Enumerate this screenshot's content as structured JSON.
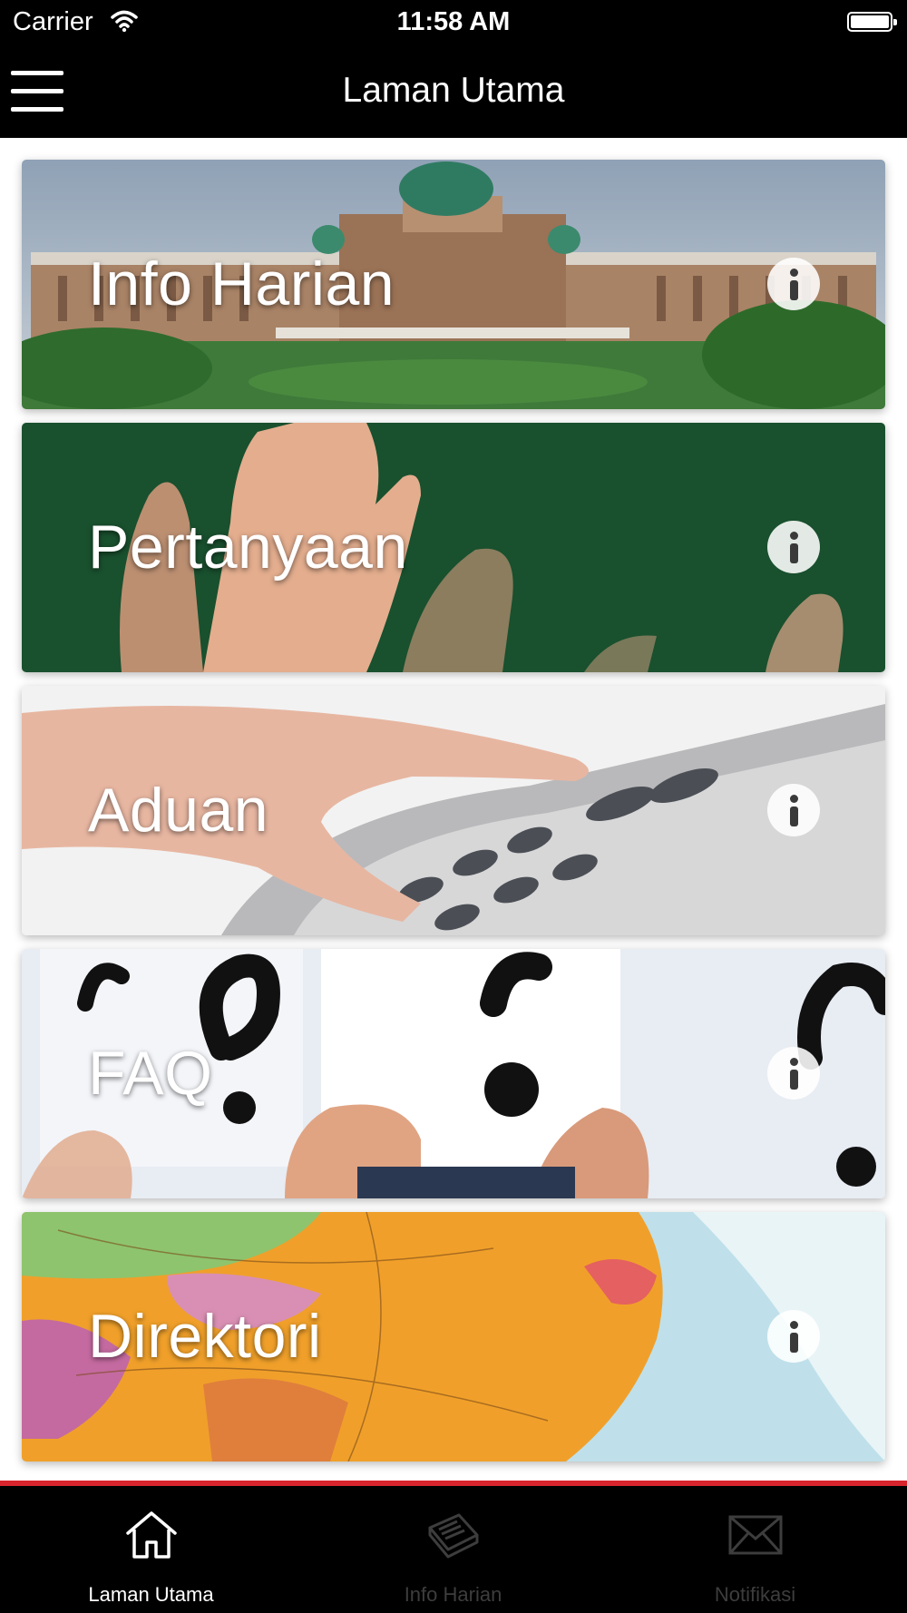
{
  "status_bar": {
    "carrier": "Carrier",
    "time": "11:58 AM"
  },
  "nav": {
    "title": "Laman Utama",
    "menu_icon": "hamburger-menu-icon"
  },
  "cards": [
    {
      "label": "Info Harian",
      "image": "government building with green domes",
      "info_icon": "info-icon"
    },
    {
      "label": "Pertanyaan",
      "image": "raised hands in front of green board",
      "info_icon": "info-icon"
    },
    {
      "label": "Aduan",
      "image": "finger pressing telephone keypad",
      "info_icon": "info-icon"
    },
    {
      "label": "FAQ",
      "image": "hands holding question mark cards",
      "info_icon": "info-icon"
    },
    {
      "label": "Direktori",
      "image": "close-up of globe map",
      "info_icon": "info-icon"
    }
  ],
  "tab_bar": {
    "accent_color": "#d8242d",
    "tabs": [
      {
        "label": "Laman Utama",
        "icon": "home-icon",
        "active": true
      },
      {
        "label": "Info Harian",
        "icon": "newspaper-icon",
        "active": false
      },
      {
        "label": "Notifikasi",
        "icon": "envelope-icon",
        "active": false
      }
    ]
  }
}
